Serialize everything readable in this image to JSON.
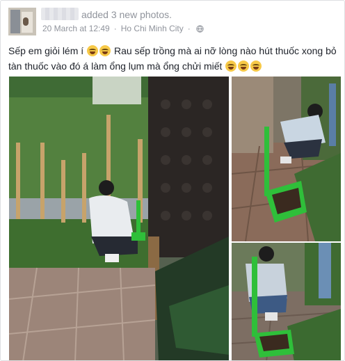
{
  "post": {
    "author_name": "",
    "action_text": "added 3 new photos.",
    "date": "20 March at 12:49",
    "separator": "·",
    "location": "Ho Chi Minh City",
    "separator2": "·",
    "privacy_icon": "globe-icon",
    "text_part1": "Sếp em giỏi lém í",
    "text_part2": "Rau sếp trồng mà ai nỡ lòng nào hút thuốc xong bỏ tàn thuốc vào đó á làm ổng lụm mà ổng chửi miết",
    "emoji_icon": "grinning-squinting-emoji"
  },
  "photos": [
    {
      "name": "photo-main",
      "description": "man crouching near vegetable garden by a wall"
    },
    {
      "name": "photo-top-right",
      "description": "man squatting holding green dustpan"
    },
    {
      "name": "photo-bottom-right",
      "description": "man kneeling with green dustpan on patio"
    }
  ],
  "colors": {
    "border": "#dddfe2",
    "meta_text": "#90949c",
    "body_text": "#1d2129",
    "dustpan_green": "#2fbf3a"
  }
}
